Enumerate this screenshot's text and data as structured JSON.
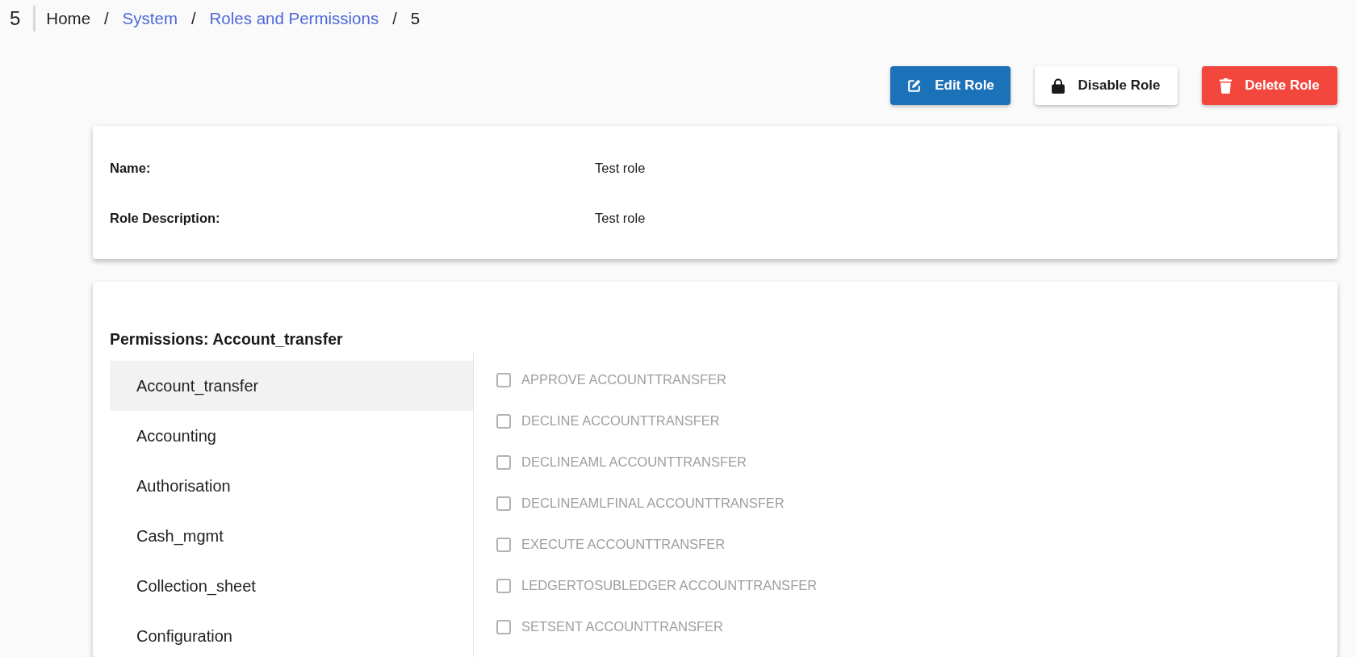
{
  "breadcrumb": {
    "page_title": "5",
    "items": [
      {
        "label": "Home",
        "link": false
      },
      {
        "separator": "/",
        "label": "System",
        "link": true
      },
      {
        "separator": "/",
        "label": "Roles and Permissions",
        "link": true
      },
      {
        "separator": "/",
        "label": "5",
        "link": false
      }
    ]
  },
  "actions": [
    {
      "label": "Edit Role",
      "kind": "edit"
    },
    {
      "label": "Disable Role",
      "kind": "disable"
    },
    {
      "label": "Delete Role",
      "kind": "delete"
    }
  ],
  "details": {
    "fields": [
      {
        "label": "Name:",
        "value": "Test role"
      },
      {
        "label": "Role Description:",
        "value": "Test role"
      }
    ]
  },
  "permissions": {
    "title": "Permissions: Account_transfer",
    "groups": [
      {
        "label": "Account_transfer",
        "selected": true
      },
      {
        "label": "Accounting",
        "selected": false
      },
      {
        "label": "Authorisation",
        "selected": false
      },
      {
        "label": "Cash_mgmt",
        "selected": false
      },
      {
        "label": "Collection_sheet",
        "selected": false
      },
      {
        "label": "Configuration",
        "selected": false
      }
    ],
    "items": [
      {
        "label": "APPROVE ACCOUNTTRANSFER",
        "checked": false,
        "disabled": true
      },
      {
        "label": "DECLINE ACCOUNTTRANSFER",
        "checked": false,
        "disabled": true
      },
      {
        "label": "DECLINEAML ACCOUNTTRANSFER",
        "checked": false,
        "disabled": true
      },
      {
        "label": "DECLINEAMLFINAL ACCOUNTTRANSFER",
        "checked": false,
        "disabled": true
      },
      {
        "label": "EXECUTE ACCOUNTTRANSFER",
        "checked": false,
        "disabled": true
      },
      {
        "label": "LEDGERTOSUBLEDGER ACCOUNTTRANSFER",
        "checked": false,
        "disabled": true
      },
      {
        "label": "SETSENT ACCOUNTTRANSFER",
        "checked": false,
        "disabled": true
      }
    ]
  }
}
